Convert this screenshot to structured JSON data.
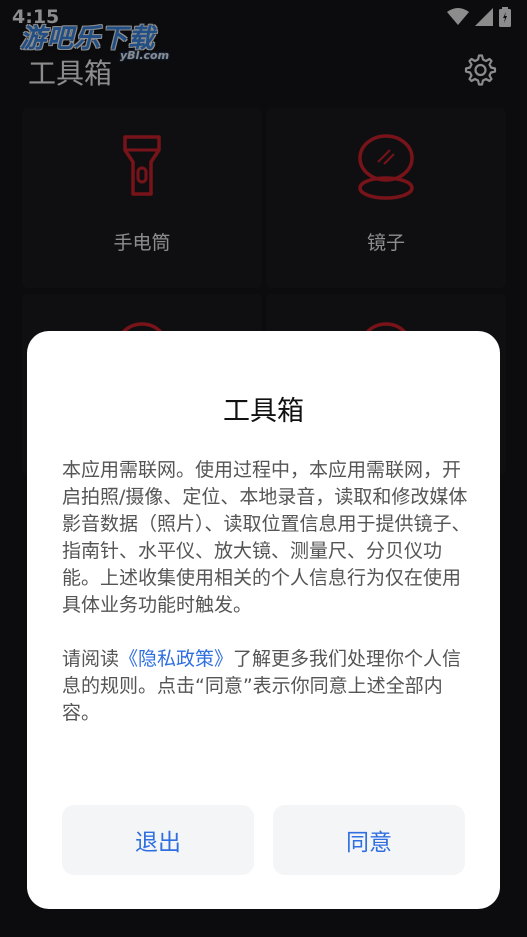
{
  "status_bar": {
    "time": "4:15"
  },
  "watermark": {
    "text": "游吧乐下载",
    "sub": "yBl.com"
  },
  "app": {
    "title": "工具箱"
  },
  "tools": [
    {
      "label": "手电筒",
      "icon": "flashlight-icon"
    },
    {
      "label": "镜子",
      "icon": "mirror-icon"
    }
  ],
  "dialog": {
    "title": "工具箱",
    "body": "本应用需联网。使用过程中，本应用需联网，开启拍照/摄像、定位、本地录音，读取和修改媒体影音数据（照片）、读取位置信息用于提供镜子、指南针、水平仪、放大镜、测量尺、分贝仪功能。上述收集使用相关的个人信息行为仅在使用具体业务功能时触发。",
    "notice_prefix": "请阅读",
    "policy_link": "《隐私政策》",
    "notice_suffix": "了解更多我们处理你个人信息的规则。点击“同意”表示你同意上述全部内容。",
    "exit_label": "退出",
    "agree_label": "同意"
  },
  "colors": {
    "accent": "#2f6fe0",
    "icon_red": "#d9232e",
    "background": "#16161a"
  }
}
